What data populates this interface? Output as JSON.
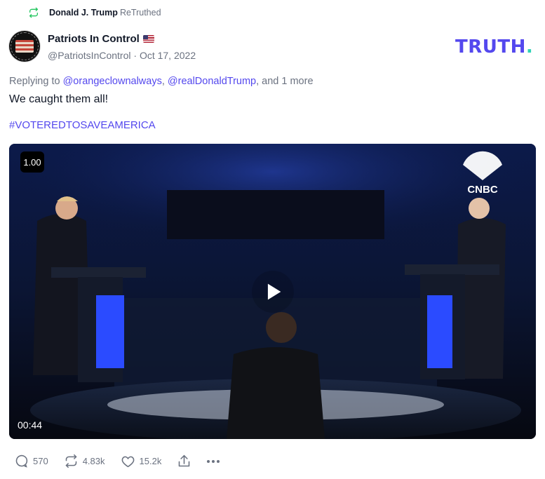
{
  "retruth": {
    "user": "Donald J. Trump",
    "label": "ReTruthed",
    "icon": "retruth-icon"
  },
  "post": {
    "author_name": "Patriots In Control",
    "author_flag": "us-flag-emoji",
    "handle": "@PatriotsInControl",
    "separator": " · ",
    "date": "Oct 17, 2022",
    "reply_prefix": "Replying to ",
    "reply_user1": "@orangeclownalways",
    "reply_comma": ", ",
    "reply_user2": "@realDonaldTrump",
    "reply_suffix": ", and 1 more",
    "text": "We caught them all!",
    "hashtag": "#VOTEREDTOSAVEAMERICA"
  },
  "brand": {
    "name": "TRUTH",
    "dot": ".",
    "color": "#5448ee",
    "dot_color": "#2fd3b6"
  },
  "video": {
    "speed": "1.00",
    "duration": "00:44",
    "watermark": "CNBC",
    "play_icon": "play-icon"
  },
  "actions": {
    "replies": "570",
    "retruths": "4.83k",
    "likes": "15.2k"
  },
  "colors": {
    "accent": "#5448ee",
    "muted": "#6b7280",
    "retruth_green": "#22c55e"
  }
}
